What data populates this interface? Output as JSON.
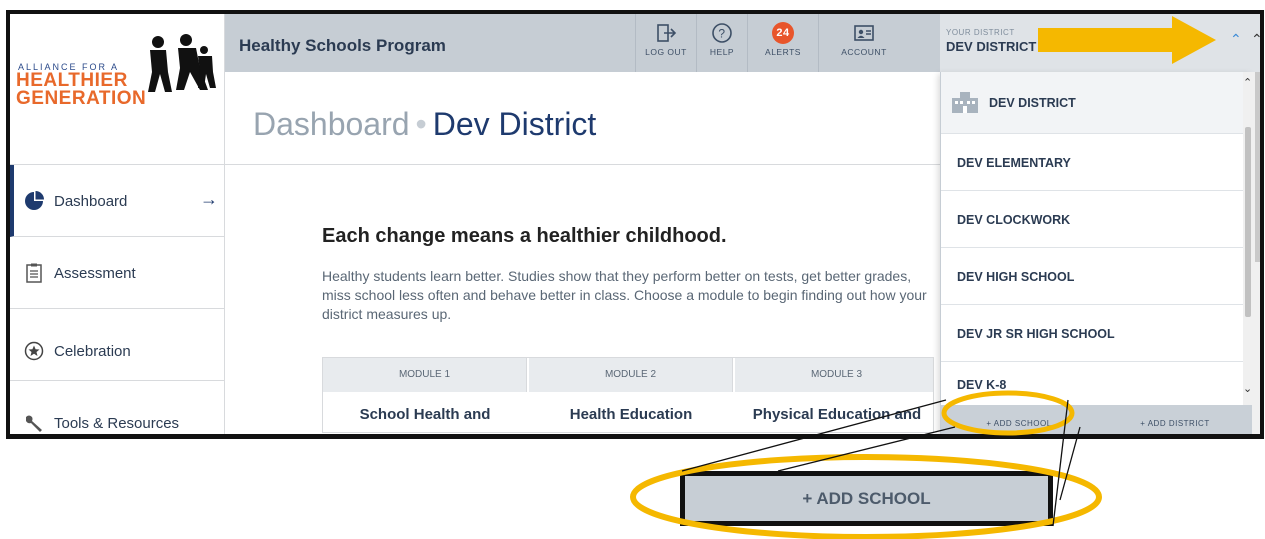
{
  "logo": {
    "line1": "ALLIANCE FOR A",
    "line2": "HEALTHIER",
    "line3": "GENERATION"
  },
  "header": {
    "program_title": "Healthy Schools Program",
    "nav": [
      {
        "label": "LOG OUT",
        "icon": "logout-icon"
      },
      {
        "label": "HELP",
        "icon": "help-icon"
      },
      {
        "label": "ALERTS",
        "icon": "alerts-badge",
        "count": "24"
      },
      {
        "label": "ACCOUNT",
        "icon": "account-icon"
      }
    ],
    "district_small": "YOUR DISTRICT",
    "district_name": "DEV DISTRICT"
  },
  "page": {
    "title_prefix": "Dashboard",
    "separator": "•",
    "title_district": "Dev District"
  },
  "sidebar": {
    "items": [
      {
        "label": "Dashboard",
        "icon": "pie-chart-icon"
      },
      {
        "label": "Assessment",
        "icon": "clipboard-icon"
      },
      {
        "label": "Celebration",
        "icon": "star-circle-icon"
      },
      {
        "label": "Tools & Resources",
        "icon": "wrench-icon"
      }
    ]
  },
  "main": {
    "hero_title": "Each change means a healthier childhood.",
    "hero_text": "Healthy students learn better. Studies show that they perform better on tests, get better grades, miss school less often and behave better in class. Choose a module to begin finding out how your district measures up.",
    "modules": [
      {
        "head": "MODULE 1",
        "title": "School Health and"
      },
      {
        "head": "MODULE 2",
        "title": "Health Education"
      },
      {
        "head": "MODULE 3",
        "title": "Physical Education and"
      }
    ]
  },
  "dropdown": {
    "items": [
      "DEV DISTRICT",
      "DEV ELEMENTARY",
      "DEV CLOCKWORK",
      "DEV HIGH SCHOOL",
      "DEV JR SR HIGH SCHOOL",
      "DEV K-8"
    ],
    "add_school": "+ ADD SCHOOL",
    "add_district": "+ ADD DISTRICT"
  },
  "callout": {
    "zoom_label": "+ ADD SCHOOL",
    "highlight_color": "#f5b800"
  },
  "colors": {
    "brand_navy": "#1e3a6e",
    "brand_orange": "#e8692b",
    "alert_red": "#e8552b",
    "topbar": "#c6cdd4"
  }
}
